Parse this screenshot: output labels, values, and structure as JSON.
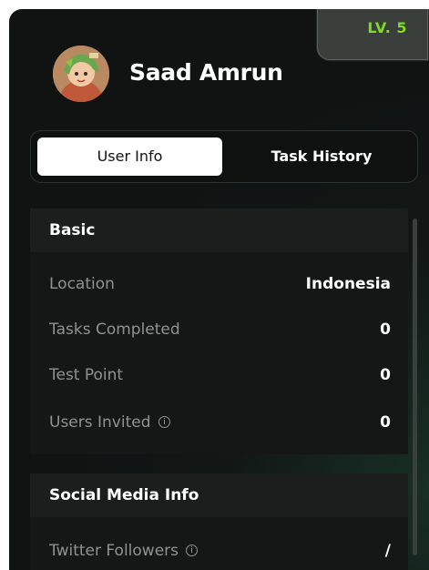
{
  "profile": {
    "level": "LV. 5",
    "name": "Saad Amrun"
  },
  "tabs": [
    {
      "label": "User Info",
      "active": true
    },
    {
      "label": "Task History",
      "active": false
    }
  ],
  "basic": {
    "title": "Basic",
    "rows": [
      {
        "label": "Location",
        "value": "Indonesia"
      },
      {
        "label": "Tasks Completed",
        "value": "0"
      },
      {
        "label": "Test Point",
        "value": "0"
      },
      {
        "label": "Users Invited",
        "value": "0",
        "info": true
      }
    ]
  },
  "social": {
    "title": "Social Media Info",
    "rows": [
      {
        "label": "Twitter Followers",
        "value": "/",
        "info": true
      }
    ]
  },
  "colors": {
    "accent_level": "#7ddc1f",
    "panel_bg": "#111313",
    "active_tab_bg": "#ffffff"
  },
  "icons": {
    "info": "info-circle-icon"
  }
}
